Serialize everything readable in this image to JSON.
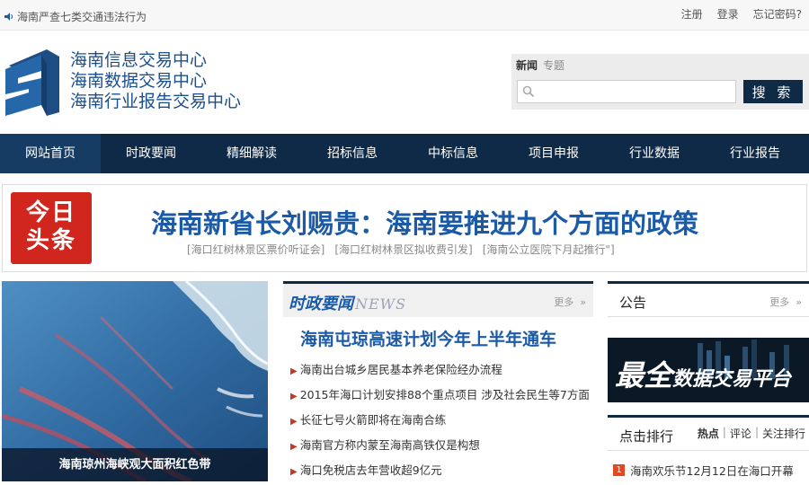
{
  "topbar": {
    "notice": "海南严查七类交通违法行为",
    "links": [
      "注册",
      "登录",
      "忘记密码?"
    ]
  },
  "logo": {
    "lines": [
      "海南信息交易中心",
      "海南数据交易中心",
      "海南行业报告交易中心"
    ]
  },
  "search": {
    "tabs": [
      "新闻",
      "专题"
    ],
    "value": "",
    "placeholder": "",
    "button": "搜 索"
  },
  "nav": {
    "items": [
      "网站首页",
      "时政要闻",
      "精细解读",
      "招标信息",
      "中标信息",
      "项目申报",
      "行业数据",
      "行业报告"
    ]
  },
  "headline": {
    "badge_top": "今日",
    "badge_bottom": "头条",
    "title": "海南新省长刘赐贵：海南要推进九个方面的政策",
    "subs": [
      "[海口红树林景区票价听证会]",
      "[海口红树林景区拟收费引发]",
      "[海南公立医院下月起推行\"]"
    ]
  },
  "photo": {
    "caption": "海南琼州海峡观大面积红色带"
  },
  "news": {
    "title": "时政要闻",
    "title_en": "NEWS",
    "more": "更多",
    "lead": "海南屯琼高速计划今年上半年通车",
    "items": [
      "海南出台城乡居民基本养老保险经办流程",
      "2015年海口计划安排88个重点项目 涉及社会民生等7方面",
      "长征七号火箭即将在海南合练",
      "海南官方称内蒙至海南高铁仅是构想",
      "海口免税店去年营收超9亿元"
    ]
  },
  "notice": {
    "title": "公告",
    "more": "更多"
  },
  "banner": {
    "text_big": "最全",
    "text_rest": "数据交易平台"
  },
  "rank": {
    "title": "点击排行",
    "tabs": [
      "热点",
      "评论",
      "关注排行"
    ],
    "items": [
      {
        "num": "1",
        "text": "海南欢乐节12月12日在海口开幕"
      }
    ]
  },
  "colors": {
    "nav_bg": "#0e2a47",
    "headline_blue": "#1b5aa6",
    "badge_red": "#d1261d"
  }
}
